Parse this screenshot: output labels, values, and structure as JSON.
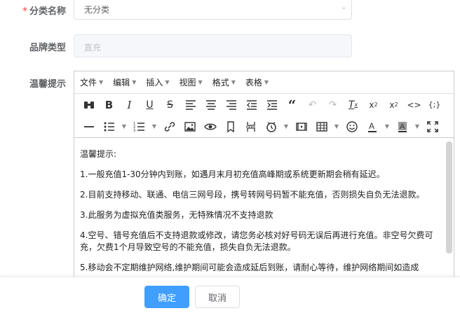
{
  "form": {
    "category": {
      "required_mark": "*",
      "label": "分类名称",
      "value": "无分类"
    },
    "brand_type": {
      "label": "品牌类型",
      "placeholder": "直充"
    },
    "tips": {
      "label": "温馨提示"
    }
  },
  "editor": {
    "menus": [
      "文件",
      "编辑",
      "插入",
      "视图",
      "格式",
      "表格"
    ],
    "content": [
      "温馨提示:",
      "1.一般充值1-30分钟内到账，如遇月末月初充值高峰期或系统更新期会稍有延迟。",
      "2.目前支持移动、联通、电信三网号段，携号转网号码暂不能充值，否则损失自负无法退款。",
      "3.此服务为虚拟充值类服务，无特殊情况不支持退款",
      "4.空号、错号充值后不支持退款或修改，请您务必核对好号码无误后再进行充值。非空号欠费可充，欠费1个月导致空号的不能充值，损失自负无法退款。",
      "5.移动会不定期维护网络,维护期间可能会造成延后到账，请耐心等待，维护网络期间如造成"
    ]
  },
  "footer": {
    "confirm_label": "确定",
    "cancel_label": "取消"
  }
}
